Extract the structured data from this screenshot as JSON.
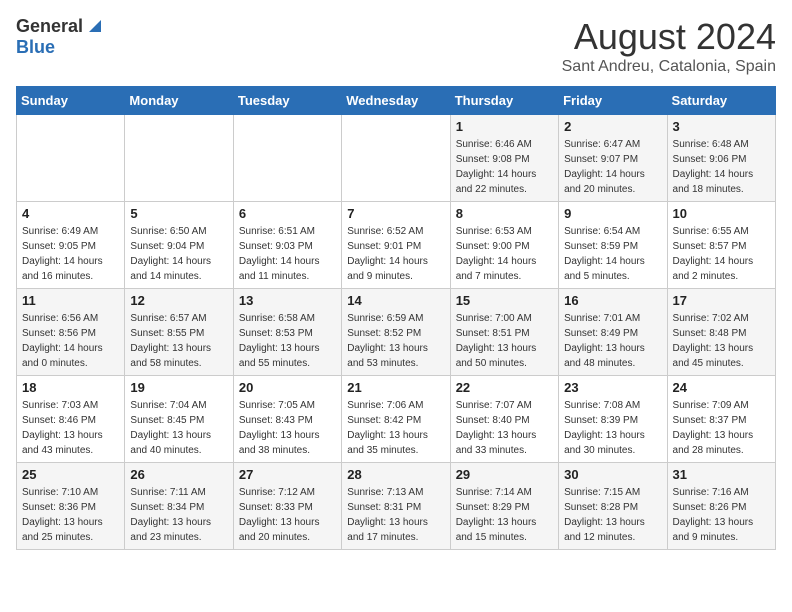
{
  "header": {
    "logo_general": "General",
    "logo_blue": "Blue",
    "month": "August 2024",
    "location": "Sant Andreu, Catalonia, Spain"
  },
  "days_of_week": [
    "Sunday",
    "Monday",
    "Tuesday",
    "Wednesday",
    "Thursday",
    "Friday",
    "Saturday"
  ],
  "weeks": [
    [
      {
        "day": "",
        "info": ""
      },
      {
        "day": "",
        "info": ""
      },
      {
        "day": "",
        "info": ""
      },
      {
        "day": "",
        "info": ""
      },
      {
        "day": "1",
        "info": "Sunrise: 6:46 AM\nSunset: 9:08 PM\nDaylight: 14 hours\nand 22 minutes."
      },
      {
        "day": "2",
        "info": "Sunrise: 6:47 AM\nSunset: 9:07 PM\nDaylight: 14 hours\nand 20 minutes."
      },
      {
        "day": "3",
        "info": "Sunrise: 6:48 AM\nSunset: 9:06 PM\nDaylight: 14 hours\nand 18 minutes."
      }
    ],
    [
      {
        "day": "4",
        "info": "Sunrise: 6:49 AM\nSunset: 9:05 PM\nDaylight: 14 hours\nand 16 minutes."
      },
      {
        "day": "5",
        "info": "Sunrise: 6:50 AM\nSunset: 9:04 PM\nDaylight: 14 hours\nand 14 minutes."
      },
      {
        "day": "6",
        "info": "Sunrise: 6:51 AM\nSunset: 9:03 PM\nDaylight: 14 hours\nand 11 minutes."
      },
      {
        "day": "7",
        "info": "Sunrise: 6:52 AM\nSunset: 9:01 PM\nDaylight: 14 hours\nand 9 minutes."
      },
      {
        "day": "8",
        "info": "Sunrise: 6:53 AM\nSunset: 9:00 PM\nDaylight: 14 hours\nand 7 minutes."
      },
      {
        "day": "9",
        "info": "Sunrise: 6:54 AM\nSunset: 8:59 PM\nDaylight: 14 hours\nand 5 minutes."
      },
      {
        "day": "10",
        "info": "Sunrise: 6:55 AM\nSunset: 8:57 PM\nDaylight: 14 hours\nand 2 minutes."
      }
    ],
    [
      {
        "day": "11",
        "info": "Sunrise: 6:56 AM\nSunset: 8:56 PM\nDaylight: 14 hours\nand 0 minutes."
      },
      {
        "day": "12",
        "info": "Sunrise: 6:57 AM\nSunset: 8:55 PM\nDaylight: 13 hours\nand 58 minutes."
      },
      {
        "day": "13",
        "info": "Sunrise: 6:58 AM\nSunset: 8:53 PM\nDaylight: 13 hours\nand 55 minutes."
      },
      {
        "day": "14",
        "info": "Sunrise: 6:59 AM\nSunset: 8:52 PM\nDaylight: 13 hours\nand 53 minutes."
      },
      {
        "day": "15",
        "info": "Sunrise: 7:00 AM\nSunset: 8:51 PM\nDaylight: 13 hours\nand 50 minutes."
      },
      {
        "day": "16",
        "info": "Sunrise: 7:01 AM\nSunset: 8:49 PM\nDaylight: 13 hours\nand 48 minutes."
      },
      {
        "day": "17",
        "info": "Sunrise: 7:02 AM\nSunset: 8:48 PM\nDaylight: 13 hours\nand 45 minutes."
      }
    ],
    [
      {
        "day": "18",
        "info": "Sunrise: 7:03 AM\nSunset: 8:46 PM\nDaylight: 13 hours\nand 43 minutes."
      },
      {
        "day": "19",
        "info": "Sunrise: 7:04 AM\nSunset: 8:45 PM\nDaylight: 13 hours\nand 40 minutes."
      },
      {
        "day": "20",
        "info": "Sunrise: 7:05 AM\nSunset: 8:43 PM\nDaylight: 13 hours\nand 38 minutes."
      },
      {
        "day": "21",
        "info": "Sunrise: 7:06 AM\nSunset: 8:42 PM\nDaylight: 13 hours\nand 35 minutes."
      },
      {
        "day": "22",
        "info": "Sunrise: 7:07 AM\nSunset: 8:40 PM\nDaylight: 13 hours\nand 33 minutes."
      },
      {
        "day": "23",
        "info": "Sunrise: 7:08 AM\nSunset: 8:39 PM\nDaylight: 13 hours\nand 30 minutes."
      },
      {
        "day": "24",
        "info": "Sunrise: 7:09 AM\nSunset: 8:37 PM\nDaylight: 13 hours\nand 28 minutes."
      }
    ],
    [
      {
        "day": "25",
        "info": "Sunrise: 7:10 AM\nSunset: 8:36 PM\nDaylight: 13 hours\nand 25 minutes."
      },
      {
        "day": "26",
        "info": "Sunrise: 7:11 AM\nSunset: 8:34 PM\nDaylight: 13 hours\nand 23 minutes."
      },
      {
        "day": "27",
        "info": "Sunrise: 7:12 AM\nSunset: 8:33 PM\nDaylight: 13 hours\nand 20 minutes."
      },
      {
        "day": "28",
        "info": "Sunrise: 7:13 AM\nSunset: 8:31 PM\nDaylight: 13 hours\nand 17 minutes."
      },
      {
        "day": "29",
        "info": "Sunrise: 7:14 AM\nSunset: 8:29 PM\nDaylight: 13 hours\nand 15 minutes."
      },
      {
        "day": "30",
        "info": "Sunrise: 7:15 AM\nSunset: 8:28 PM\nDaylight: 13 hours\nand 12 minutes."
      },
      {
        "day": "31",
        "info": "Sunrise: 7:16 AM\nSunset: 8:26 PM\nDaylight: 13 hours\nand 9 minutes."
      }
    ]
  ]
}
